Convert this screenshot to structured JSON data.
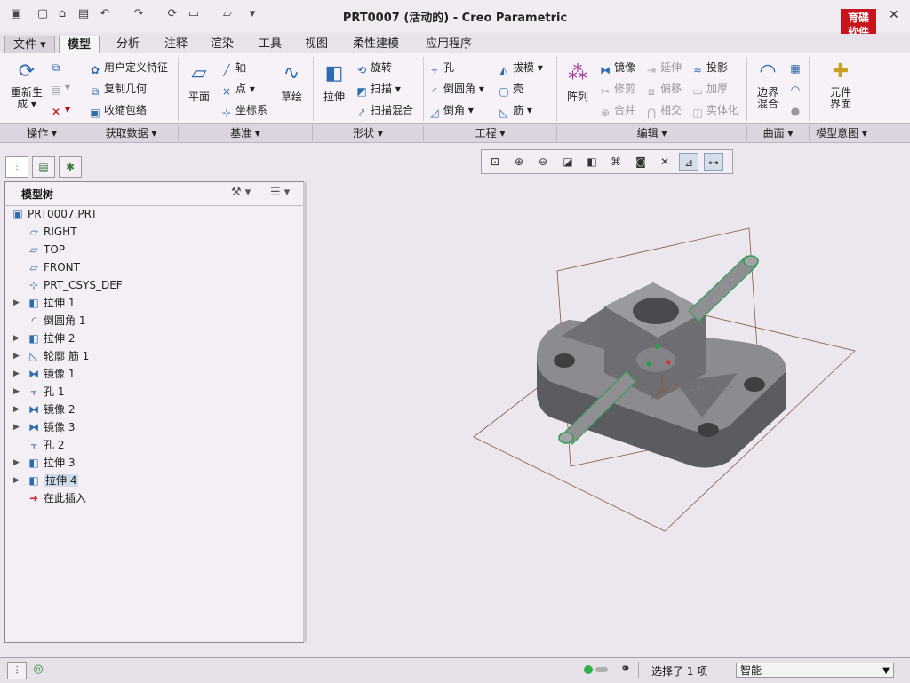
{
  "window": {
    "title": "PRT0007 (活动的) - Creo Parametric",
    "logo_text": "育碟\n软件"
  },
  "quick_access": [
    "new-icon",
    "open-icon",
    "save-icon",
    "undo-icon",
    "redo-icon",
    "regenerate-icon",
    "windows-icon",
    "close-window-icon",
    "customize-icon"
  ],
  "tabs": [
    {
      "label": "文件 ▾"
    },
    {
      "label": "模型"
    },
    {
      "label": "分析"
    },
    {
      "label": "注释"
    },
    {
      "label": "渲染"
    },
    {
      "label": "工具"
    },
    {
      "label": "视图"
    },
    {
      "label": "柔性建模"
    },
    {
      "label": "应用程序"
    }
  ],
  "ribbon": {
    "regenerate": "重新生\n成 ▾",
    "get_data": {
      "user_feature": "用户定义特征",
      "copy_geom": "复制几何",
      "shrinkwrap": "收缩包络"
    },
    "datum": {
      "plane": "平面",
      "axis": "轴",
      "point": "点",
      "csys": "坐标系",
      "sketch": "草绘"
    },
    "shapes": {
      "extrude": "拉伸",
      "revolve": "旋转",
      "sweep": "扫描",
      "swept_blend": "扫描混合"
    },
    "engineering": {
      "hole": "孔",
      "round": "倒圆角",
      "chamfer": "倒角",
      "draft": "拔模",
      "shell": "壳",
      "rib": "筋"
    },
    "editing": {
      "pattern": "阵列",
      "mirror": "镜像",
      "trim": "修剪",
      "merge": "合并",
      "extend": "延伸",
      "offset": "偏移",
      "intersect": "相交",
      "project": "投影",
      "thicken": "加厚",
      "solidify": "实体化"
    },
    "surfaces": {
      "boundary_blend": "边界\n混合"
    },
    "model_intent": {
      "component_interface": "元件\n界面"
    }
  },
  "groups": [
    {
      "label": "操作 ▾"
    },
    {
      "label": "获取数据 ▾"
    },
    {
      "label": "基准 ▾"
    },
    {
      "label": "形状 ▾"
    },
    {
      "label": "工程 ▾"
    },
    {
      "label": "编辑 ▾"
    },
    {
      "label": "曲面 ▾"
    },
    {
      "label": "模型意图 ▾"
    }
  ],
  "model_tree": {
    "title": "模型树",
    "items": [
      {
        "label": "PRT0007.PRT",
        "icon": "part-icon",
        "expandable": false
      },
      {
        "label": "RIGHT",
        "icon": "datum-plane-icon",
        "expandable": false
      },
      {
        "label": "TOP",
        "icon": "datum-plane-icon",
        "expandable": false
      },
      {
        "label": "FRONT",
        "icon": "datum-plane-icon",
        "expandable": false
      },
      {
        "label": "PRT_CSYS_DEF",
        "icon": "csys-icon",
        "expandable": false
      },
      {
        "label": "拉伸 1",
        "icon": "extrude-icon",
        "expandable": true
      },
      {
        "label": "倒圆角 1",
        "icon": "round-icon",
        "expandable": false
      },
      {
        "label": "拉伸 2",
        "icon": "extrude-icon",
        "expandable": true
      },
      {
        "label": "轮廓 筋 1",
        "icon": "rib-icon",
        "expandable": true
      },
      {
        "label": "镜像 1",
        "icon": "mirror-icon",
        "expandable": true
      },
      {
        "label": "孔 1",
        "icon": "hole-icon",
        "expandable": true
      },
      {
        "label": "镜像 2",
        "icon": "mirror-icon",
        "expandable": true
      },
      {
        "label": "镜像 3",
        "icon": "mirror-icon",
        "expandable": true
      },
      {
        "label": "孔 2",
        "icon": "hole-icon",
        "expandable": false
      },
      {
        "label": "拉伸 3",
        "icon": "extrude-icon",
        "expandable": true
      },
      {
        "label": "拉伸 4",
        "icon": "extrude-icon",
        "expandable": true
      },
      {
        "label": "在此插入",
        "icon": "insert-here-icon",
        "expandable": false
      }
    ]
  },
  "model_view": {
    "csys_label": "PRT_CSYS_DEF"
  },
  "status": {
    "selection": "选择了 1 项",
    "filter": "智能"
  },
  "colors": {
    "accent": "#2e6bb0",
    "selected_row": "#cfdcec",
    "logo_red": "#c8141c"
  }
}
